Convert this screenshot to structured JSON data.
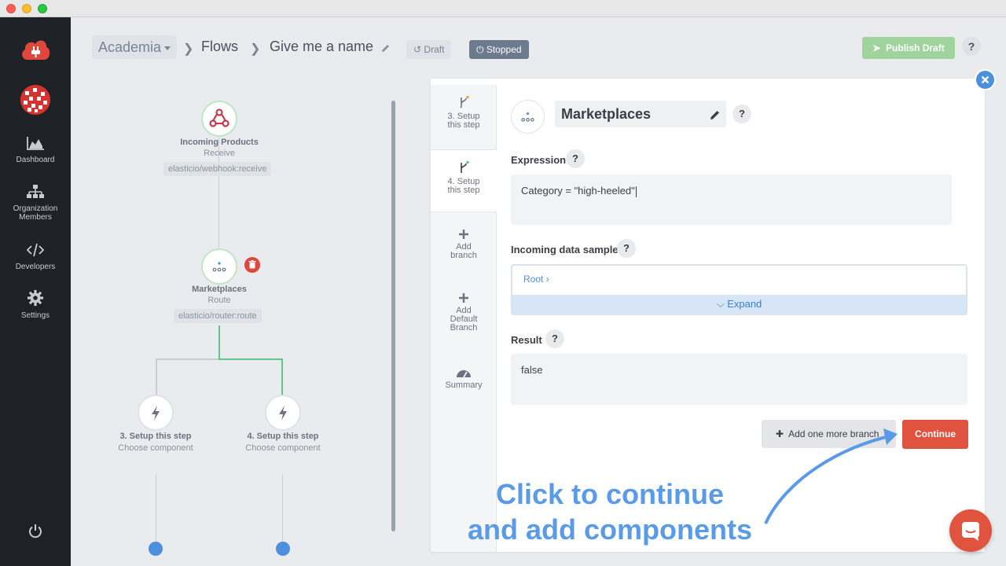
{
  "window": {
    "controls": [
      "close",
      "minimize",
      "zoom"
    ]
  },
  "sidebar": {
    "logo_icon": "plug-cloud-icon",
    "items": [
      {
        "label": "Dashboard",
        "icon": "chart-area-icon"
      },
      {
        "label": "Organization Members",
        "icon": "org-chart-icon"
      },
      {
        "label": "Developers",
        "icon": "code-icon"
      },
      {
        "label": "Settings",
        "icon": "gear-icon"
      }
    ],
    "item_lines": {
      "dashboard": "Dashboard",
      "org_line1": "Organization",
      "org_line2": "Members",
      "developers": "Developers",
      "settings": "Settings"
    },
    "power_icon": "power-icon"
  },
  "header": {
    "workspace": "Academia",
    "breadcrumb_flows": "Flows",
    "flow_name": "Give me a name",
    "draft_badge": "Draft",
    "status_badge": "Stopped",
    "publish_label": "Publish Draft",
    "help": "?"
  },
  "flow": {
    "nodes": [
      {
        "title": "Incoming Products",
        "subtitle": "Receive",
        "tag": "elasticio/webhook:receive",
        "icon": "webhook-icon"
      },
      {
        "title": "Marketplaces",
        "subtitle": "Route",
        "tag": "elasticio/router:route",
        "icon": "router-icon"
      },
      {
        "title": "3. Setup this step",
        "subtitle": "Choose component",
        "icon": "bolt-icon"
      },
      {
        "title": "4. Setup this step",
        "subtitle": "Choose component",
        "icon": "bolt-icon"
      }
    ]
  },
  "steps": {
    "item3_l1": "3. Setup",
    "item3_l2": "this step",
    "item4_l1": "4. Setup",
    "item4_l2": "this step",
    "add_branch_l1": "Add",
    "add_branch_l2": "branch",
    "add_default_l1": "Add",
    "add_default_l2": "Default",
    "add_default_l3": "Branch",
    "summary": "Summary"
  },
  "editor": {
    "step_name": "Marketplaces",
    "expression_label": "Expression",
    "expression_value": "Category = \"high-heeled\"",
    "sample_label": "Incoming data sample",
    "root_link": "Root",
    "expand_label": "Expand",
    "result_label": "Result",
    "result_value": "false",
    "add_branch_label": "Add one more branch",
    "continue_label": "Continue",
    "help": "?"
  },
  "callout": {
    "line1": "Click to continue",
    "line2": "and add components"
  },
  "colors": {
    "accent_blue": "#4c8fdd",
    "continue_red": "#e0533f",
    "publish_green": "#9fd49c",
    "sidebar_bg": "#1e2226"
  }
}
